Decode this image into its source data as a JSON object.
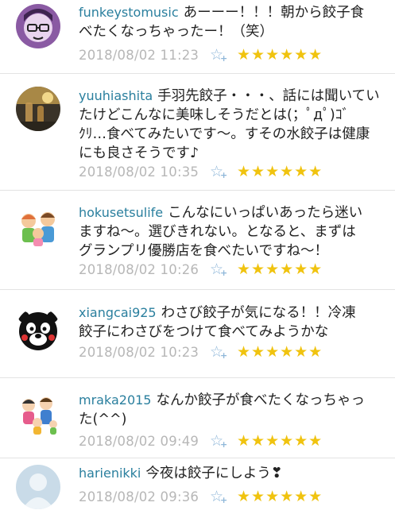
{
  "comments": [
    {
      "user": "funkeystomusic",
      "lines": [
        "あーーー！！！朝から餃子食",
        "べたくなっちゃったー！（笑）"
      ],
      "time": "2018/08/02 11:23",
      "stars": "★★★★★★",
      "avatar": "glasses-person-avatar"
    },
    {
      "user": "yuuhiashita",
      "lines": [
        "手羽先餃子・・・、話には聞いてい",
        "たけどこんなに美味しそうだとは(；ﾟдﾟ)ｺﾞ",
        "ｸﾘ…食べてみたいです～。すその水餃子は健康",
        "にも良さそうです♪"
      ],
      "time": "2018/08/02 10:35",
      "stars": "★★★★★★",
      "avatar": "sunset-glass-avatar"
    },
    {
      "user": "hokusetsulife",
      "lines": [
        "こんなにいっぱいあったら迷い",
        "ますね～。選びきれない。となると、まずは",
        "グランプリ優勝店を食べたいですね～！"
      ],
      "time": "2018/08/02 10:26",
      "stars": "★★★★★★",
      "avatar": "family-avatar"
    },
    {
      "user": "xiangcai925",
      "lines": [
        "わさび餃子が気になる！！冷凍",
        "餃子にわさびをつけて食べてみようかな"
      ],
      "time": "2018/08/02 10:23",
      "stars": "★★★★★★",
      "avatar": "black-bear-avatar"
    },
    {
      "user": "mraka2015",
      "lines": [
        "なんか餃子が食べたくなっちゃっ",
        "た(^^)"
      ],
      "time": "2018/08/02 09:49",
      "stars": "★★★★★★",
      "avatar": "family-group-avatar"
    },
    {
      "user": "harienikki",
      "lines": [
        "今夜は餃子にしよう❣"
      ],
      "time": "2018/08/02 09:36",
      "stars": "★★★★★★",
      "avatar": "default-person-avatar"
    }
  ],
  "colors": {
    "username": "#2a7f9e",
    "timestamp": "#b7b7b7",
    "star": "#f0c30f",
    "fav_icon": "#8fb7d9"
  },
  "fav_icon": "star-plus-icon",
  "fav_plus": "+",
  "fav_star": "☆"
}
